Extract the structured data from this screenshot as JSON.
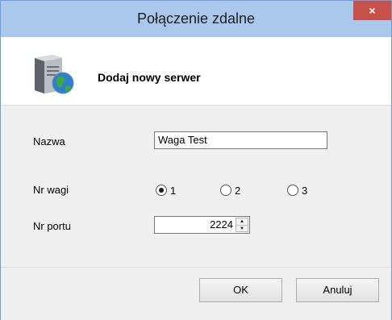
{
  "window": {
    "title": "Połączenie zdalne",
    "close_glyph": "×"
  },
  "header": {
    "text": "Dodaj nowy serwer",
    "icon": "server-globe-icon"
  },
  "form": {
    "name_label": "Nazwa",
    "name_value": "Waga Test",
    "scale_label": "Nr wagi",
    "scale_options": [
      "1",
      "2",
      "3"
    ],
    "scale_selected": "1",
    "port_label": "Nr portu",
    "port_value": "2224"
  },
  "buttons": {
    "ok": "OK",
    "cancel": "Anuluj"
  },
  "colors": {
    "titlebar": "#a9c8ec",
    "close": "#c7504a",
    "border": "#6b9fd3"
  }
}
